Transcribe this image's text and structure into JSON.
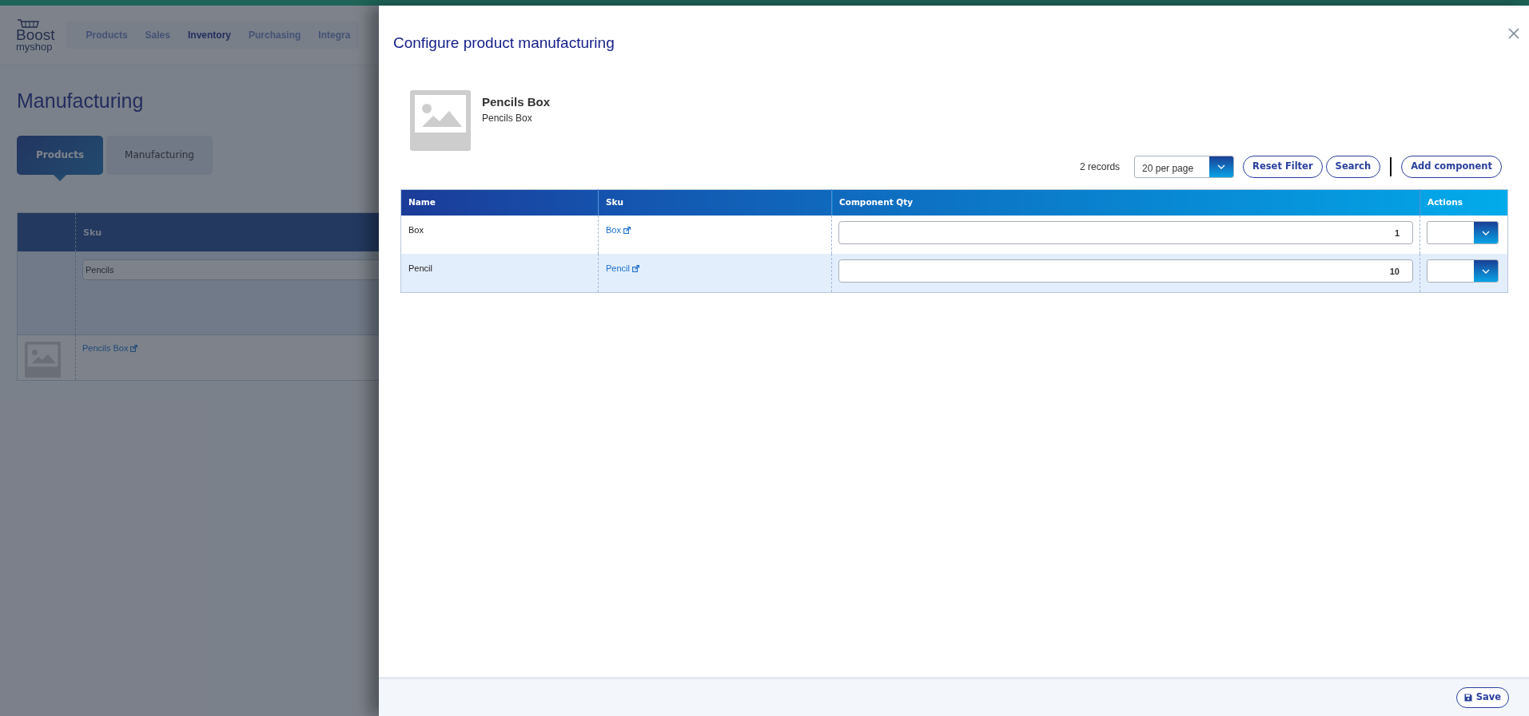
{
  "app": {
    "logo": {
      "top": "Boost",
      "bottom": "myshop"
    },
    "nav": [
      {
        "label": "Products",
        "selected": false
      },
      {
        "label": "Sales",
        "selected": false
      },
      {
        "label": "Inventory",
        "selected": true
      },
      {
        "label": "Purchasing",
        "selected": false
      },
      {
        "label": "Integra",
        "selected": false
      }
    ],
    "page_title": "Manufacturing",
    "tabs": [
      {
        "label": "Products",
        "selected": true
      },
      {
        "label": "Manufacturing",
        "selected": false
      }
    ],
    "grid": {
      "columns": [
        "Sku"
      ],
      "filter": "Pencils",
      "rows": [
        {
          "sku": "Pencils Box"
        }
      ]
    }
  },
  "modal": {
    "title": "Configure product manufacturing",
    "product": {
      "name": "Pencils Box",
      "subtitle": "Pencils Box"
    },
    "toolbar": {
      "records": "2 records",
      "per_page": "20 per page",
      "buttons": [
        "Reset Filter",
        "Search"
      ],
      "add_button": "Add component"
    },
    "table": {
      "columns": [
        "Name",
        "Sku",
        "Component Qty",
        "Actions"
      ],
      "rows": [
        {
          "name": "Box",
          "sku": "Box",
          "qty": "1"
        },
        {
          "name": "Pencil",
          "sku": "Pencil",
          "qty": "10"
        }
      ]
    },
    "footer": {
      "save": "Save"
    }
  }
}
